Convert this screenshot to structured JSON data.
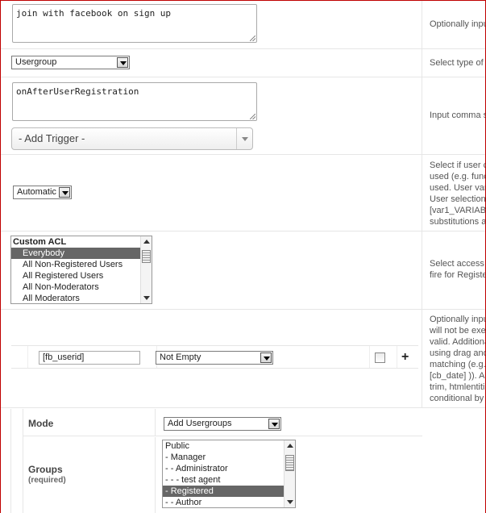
{
  "sign_up_text": {
    "value": "join with facebook on sign up",
    "description": "Optionally inpu"
  },
  "type_select": {
    "value": "Usergroup",
    "description": "Select type of"
  },
  "triggers": {
    "value": "onAfterUserRegistration",
    "add_trigger": "- Add Trigger -",
    "description": "Input comma s"
  },
  "user_select": {
    "value": "Automatic",
    "description": [
      "Select if user c",
      "used (e.g. func",
      "used. User var",
      "User selection",
      "[var1_VARIAB",
      "substitutions a"
    ]
  },
  "access": {
    "items": [
      {
        "label": "Custom ACL",
        "type": "group"
      },
      {
        "label": "Everybody",
        "selected": true
      },
      {
        "label": "All Non-Registered Users"
      },
      {
        "label": "All Registered Users"
      },
      {
        "label": "All Non-Moderators"
      },
      {
        "label": "All Moderators"
      }
    ],
    "description": [
      "Select access",
      "fire for Registe"
    ]
  },
  "conditional": {
    "field": "[fb_userid]",
    "operator": "Not Empty",
    "add": "+",
    "description": [
      "Optionally inpu",
      "will not be exe",
      "valid. Additiona",
      "using drag and",
      "matching (e.g.",
      "[cb_date] )). A",
      "trim, htmlentitie",
      "conditional by"
    ]
  },
  "mode": {
    "label": "Mode",
    "value": "Add Usergroups"
  },
  "groups": {
    "label": "Groups",
    "required": "(required)",
    "items": [
      {
        "label": "Public"
      },
      {
        "label": "- Manager"
      },
      {
        "label": "- - Administrator"
      },
      {
        "label": "- - - test agent"
      },
      {
        "label": "- Registered",
        "selected": true
      },
      {
        "label": "- - Author"
      }
    ]
  }
}
